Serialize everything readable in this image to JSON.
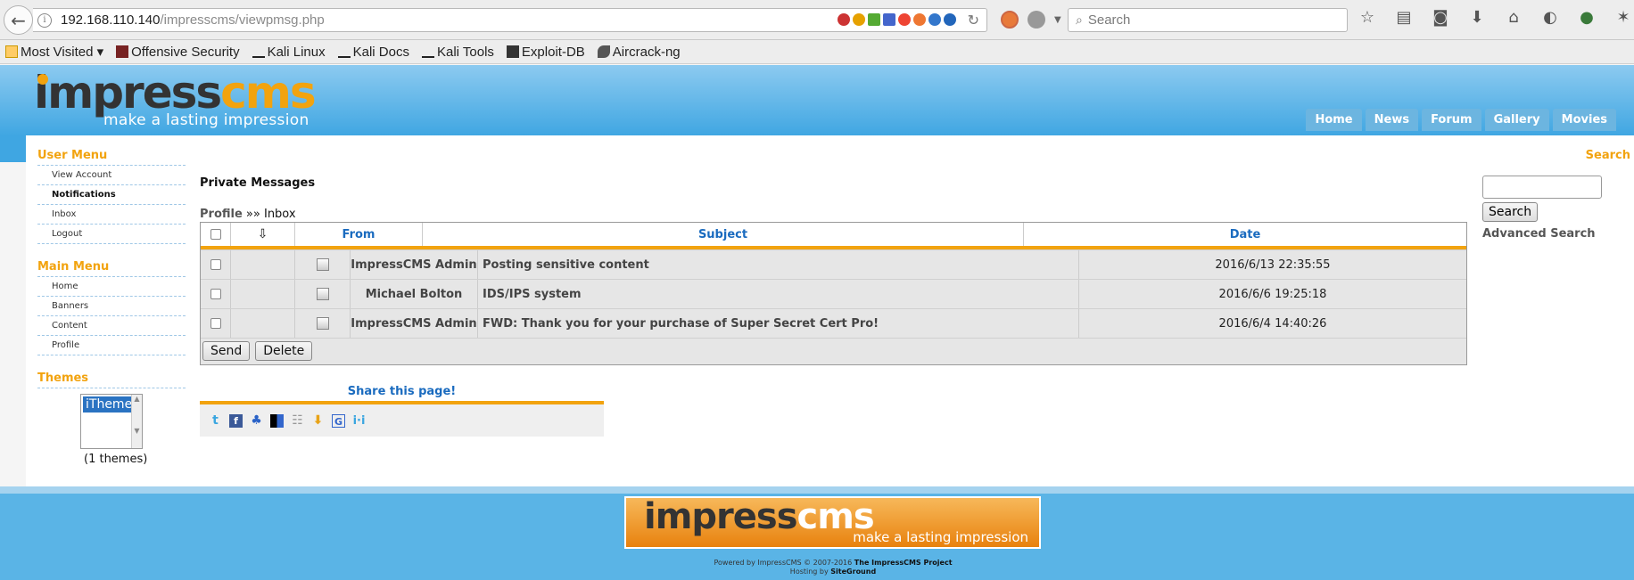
{
  "browser": {
    "url_host": "192.168.110.140",
    "url_path": "/impresscms/viewpmsg.php",
    "search_placeholder": "Search",
    "bookmarks": [
      "Most Visited ▾",
      "Offensive Security",
      "Kali Linux",
      "Kali Docs",
      "Kali Tools",
      "Exploit-DB",
      "Aircrack-ng"
    ]
  },
  "site": {
    "logo_main_a": "impress",
    "logo_main_b": "cms",
    "logo_tagline": "make a lasting impression",
    "nav": [
      "Home",
      "News",
      "Forum",
      "Gallery",
      "Movies"
    ]
  },
  "left": {
    "user_menu_title": "User Menu",
    "user_menu": [
      "View Account",
      "Notifications",
      "Inbox",
      "Logout"
    ],
    "main_menu_title": "Main Menu",
    "main_menu": [
      "Home",
      "Banners",
      "Content",
      "Profile"
    ],
    "themes_title": "Themes",
    "theme_selected": "iTheme",
    "theme_count": "(1 themes)"
  },
  "main": {
    "title": "Private Messages",
    "breadcrumb_link": "Profile",
    "breadcrumb_sep": "»»",
    "breadcrumb_current": "Inbox",
    "headers": {
      "from": "From",
      "subject": "Subject",
      "date": "Date"
    },
    "messages": [
      {
        "from": "ImpressCMS Admin",
        "subject": "Posting sensitive content",
        "date": "2016/6/13 22:35:55"
      },
      {
        "from": "Michael Bolton",
        "subject": "IDS/IPS system",
        "date": "2016/6/6 19:25:18"
      },
      {
        "from": "ImpressCMS Admin",
        "subject": "FWD: Thank you for your purchase of Super Secret Cert Pro!",
        "date": "2016/6/4 14:40:26"
      }
    ],
    "send_label": "Send",
    "delete_label": "Delete",
    "share_title": "Share this page!"
  },
  "right": {
    "search_title": "Search",
    "search_button": "Search",
    "advanced": "Advanced Search"
  },
  "footer": {
    "powered": "Powered by ImpressCMS © 2007-2016",
    "project": "The ImpressCMS Project",
    "hosting": "Hosting by",
    "host": "SiteGround"
  }
}
